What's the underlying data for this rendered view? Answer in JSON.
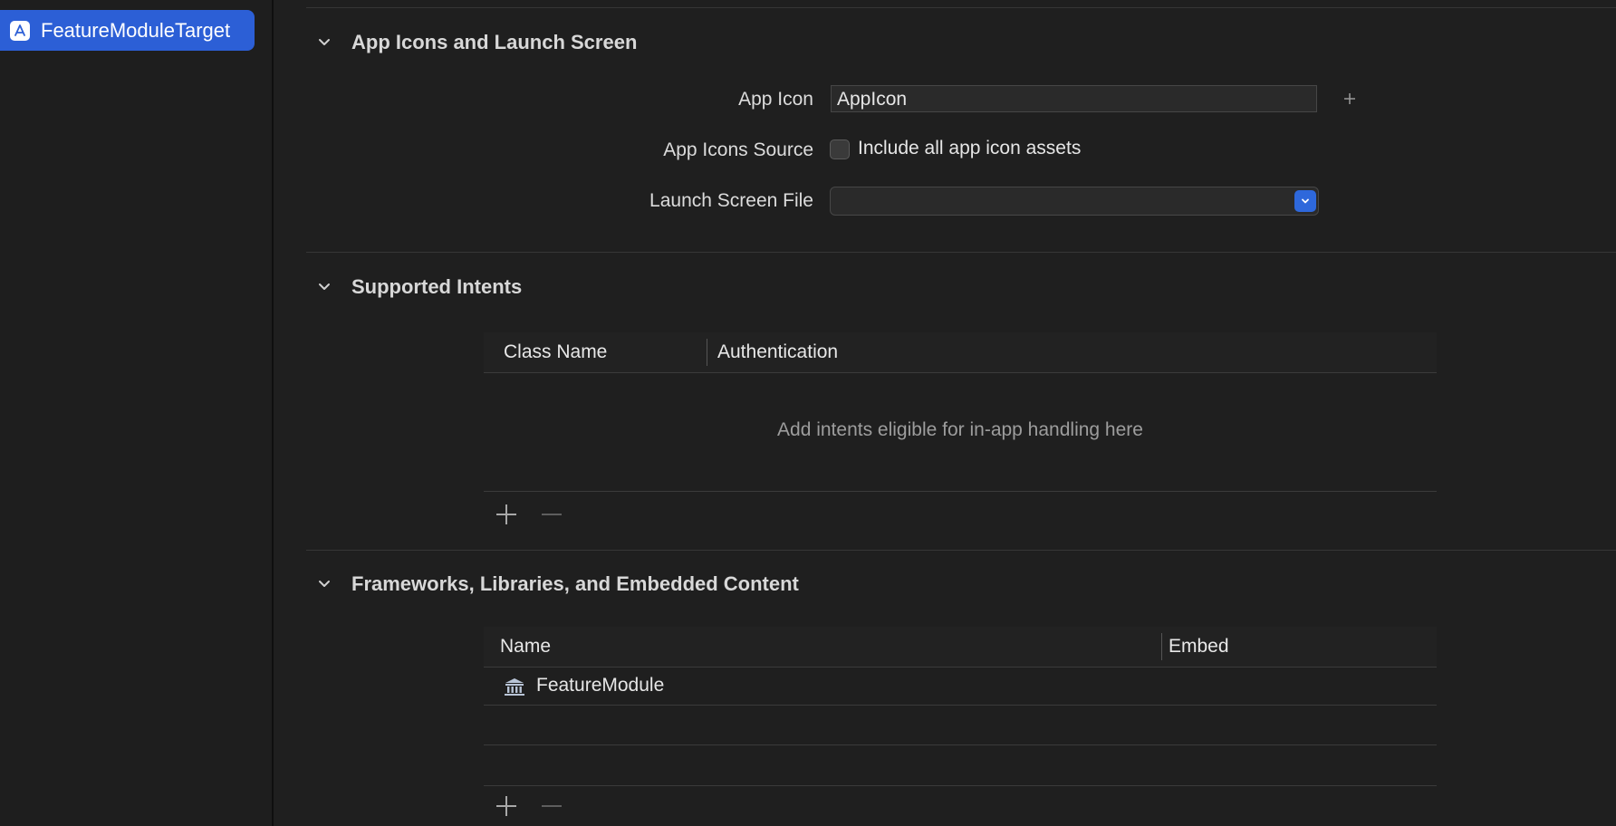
{
  "sidebar": {
    "target_label": "FeatureModuleTarget"
  },
  "sections": {
    "app_icons": {
      "title": "App Icons and Launch Screen",
      "app_icon_label": "App Icon",
      "app_icon_value": "AppIcon",
      "icons_source_label": "App Icons Source",
      "include_all_label": "Include all app icon assets",
      "include_all_checked": false,
      "launch_screen_label": "Launch Screen File",
      "launch_screen_value": ""
    },
    "intents": {
      "title": "Supported Intents",
      "columns": [
        "Class Name",
        "Authentication"
      ],
      "empty_message": "Add intents eligible for in-app handling here"
    },
    "frameworks": {
      "title": "Frameworks, Libraries, and Embedded Content",
      "columns": [
        "Name",
        "Embed"
      ],
      "rows": [
        {
          "name": "FeatureModule",
          "embed": ""
        }
      ]
    }
  },
  "icons": {
    "target": "app-target-icon",
    "chevron": "chevron-down-icon",
    "framework": "framework-building-icon",
    "add": "plus-icon",
    "remove": "minus-icon"
  },
  "colors": {
    "accent": "#2c5fd6",
    "popup_accent": "#2e68db",
    "background": "#1f1f1f"
  }
}
